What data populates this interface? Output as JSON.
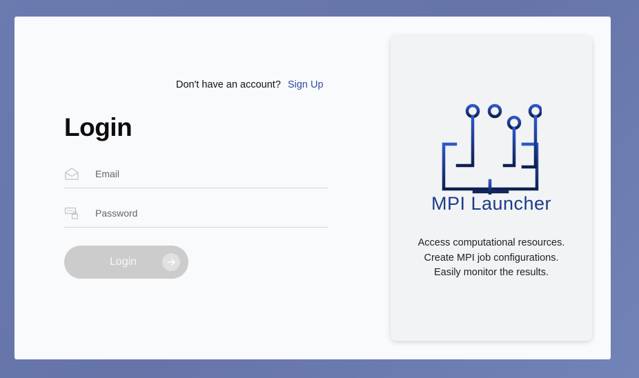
{
  "auth": {
    "signup_prompt": "Don't have an account?",
    "signup_link": "Sign Up"
  },
  "login": {
    "title": "Login",
    "email_placeholder": "Email",
    "password_placeholder": "Password",
    "submit_label": "Login"
  },
  "promo": {
    "brand": "MPI Launcher",
    "tagline": [
      "Access computational resources.",
      "Create MPI job configurations.",
      "Easily monitor the results."
    ]
  },
  "icons": {
    "email": "envelope-icon",
    "password": "password-lock-icon",
    "submit": "arrow-right-icon",
    "logo": "circuit-monitor-logo"
  },
  "colors": {
    "background": "#6a7bb0",
    "link": "#2f4f9a",
    "brand": "#1c3c8a",
    "button_disabled": "#cccccc"
  }
}
